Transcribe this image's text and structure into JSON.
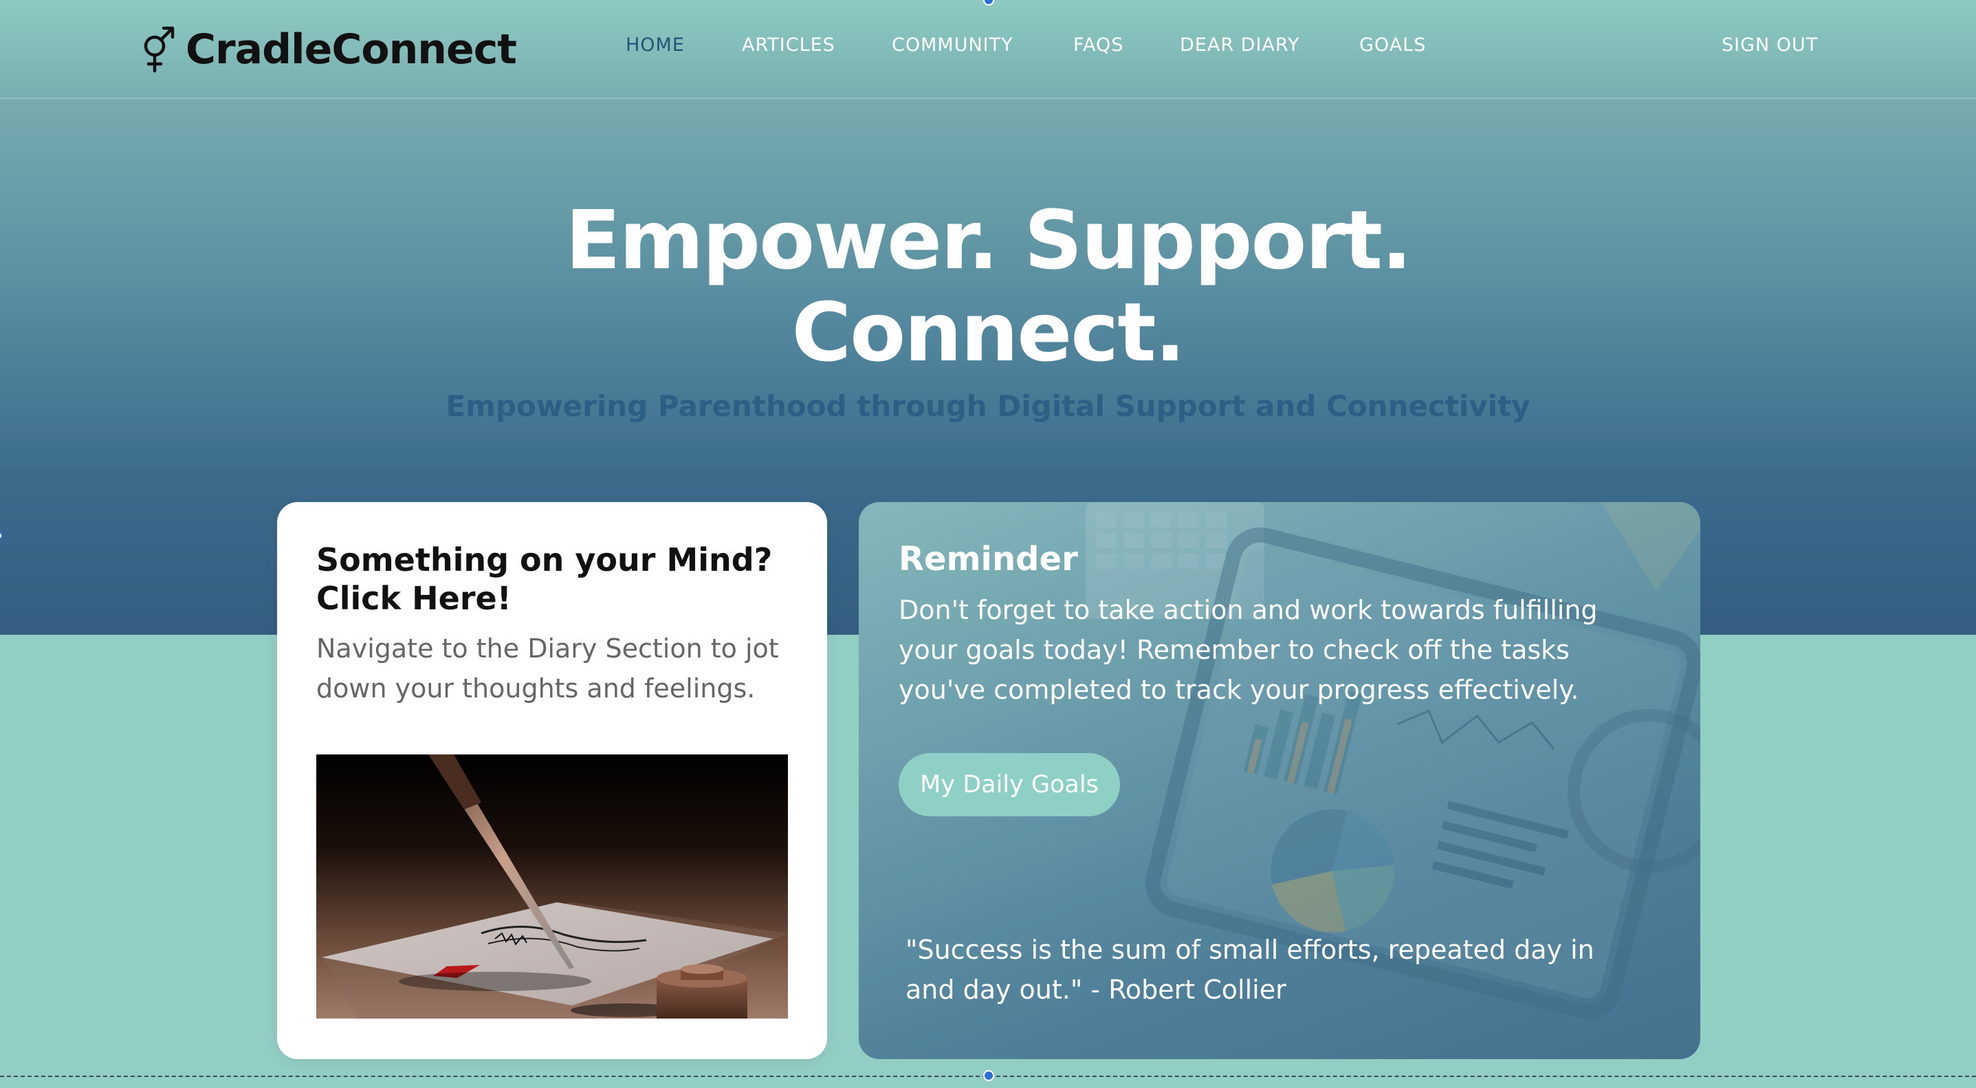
{
  "brand": {
    "name": "CradleConnect",
    "logo_icon": "gender-symbol-icon"
  },
  "nav": {
    "items": [
      {
        "label": "HOME",
        "active": true
      },
      {
        "label": "ARTICLES",
        "active": false
      },
      {
        "label": "COMMUNITY",
        "active": false
      },
      {
        "label": "FAQS",
        "active": false
      },
      {
        "label": "DEAR DIARY",
        "active": false
      },
      {
        "label": "GOALS",
        "active": false
      }
    ],
    "sign_out": "SIGN OUT"
  },
  "hero": {
    "title_line1": "Empower. Support.",
    "title_line2": "Connect.",
    "subtitle": "Empowering Parenthood through Digital Support and Connectivity"
  },
  "diary_card": {
    "title": "Something on your Mind? Click Here!",
    "description": "Navigate to the Diary Section to jot down your thoughts and feelings.",
    "image": "pen-writing-on-paper-illustration"
  },
  "reminder_card": {
    "title": "Reminder",
    "text": "Don't forget to take action and work towards fulfilling your goals today! Remember to check off the tasks you've completed to track your progress effectively.",
    "button_label": "My Daily Goals",
    "quote": "\"Success is the sum of small efforts, repeated day in and day out.\" - Robert Collier",
    "background_image": "tablet-analytics-dashboard-photo"
  },
  "colors": {
    "page_bg": "#93cec5",
    "hero_dark": "#335e81",
    "subtitle": "#2d5e84",
    "active_nav": "#23537a",
    "button_bg": "#8fd0c6"
  }
}
